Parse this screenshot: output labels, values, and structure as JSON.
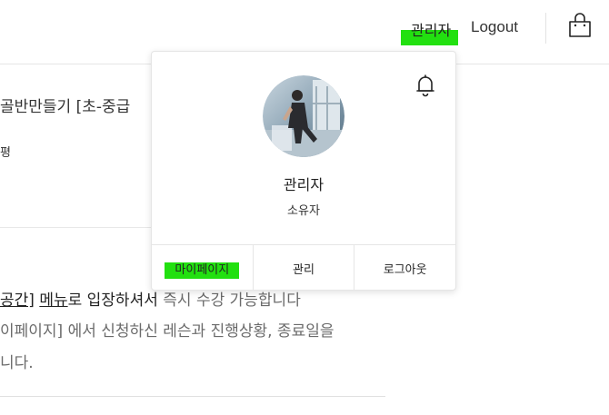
{
  "header": {
    "user_label": "관리자",
    "logout_label": "Logout",
    "cart_icon": "shopping-bag-icon"
  },
  "background": {
    "course_title": "골반만들기 [초-중급",
    "sub_label": "평",
    "line1_part1": "공간]",
    "line1_part2": "메뉴",
    "line1_part3": "로 입장하셔서",
    "line1_part4": " 즉시 수강 가능합니다",
    "line2": "이페이지] 에서 신청하신 레슨과 진행상황, 종료일을",
    "line3": "니다."
  },
  "popup": {
    "bell_icon": "bell-icon",
    "avatar_icon": "avatar",
    "name": "관리자",
    "role": "소유자",
    "actions": [
      {
        "label": "마이페이지"
      },
      {
        "label": "관리"
      },
      {
        "label": "로그아웃"
      }
    ]
  },
  "colors": {
    "highlight": "#22e010",
    "border": "#e6e6e6",
    "text": "#222222"
  }
}
